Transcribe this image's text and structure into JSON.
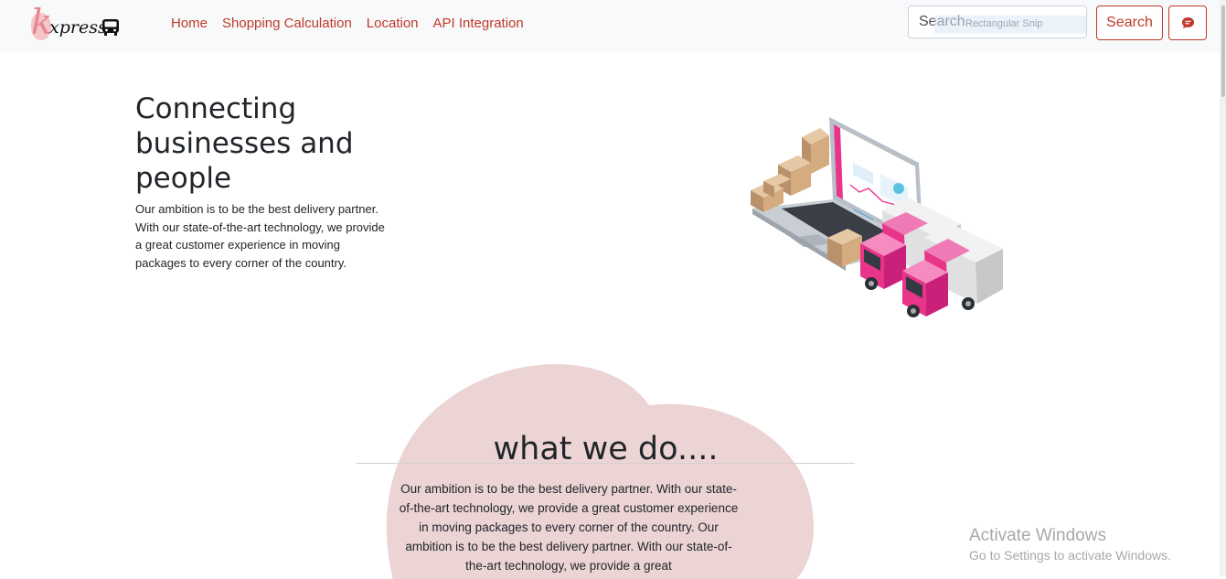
{
  "brand": {
    "letter": "k",
    "name": "xpress"
  },
  "nav": {
    "links": [
      "Home",
      "Shopping Calculation",
      "Location",
      "API Integration"
    ],
    "search_placeholder": "Search",
    "search_button": "Search",
    "snip_hint": "Rectangular Snip"
  },
  "hero": {
    "title": "Connecting businesses and people",
    "text": "Our ambition is to be the best delivery partner. With our state-of-the-art technology, we provide a great customer experience in moving packages to every corner of the country."
  },
  "section": {
    "title": "what we do....",
    "text": "Our ambition is to be the best delivery partner. With our state-of-the-art technology, we provide a great customer experience in moving packages to every corner of the country. Our ambition is to be the best delivery partner. With our state-of-the-art technology, we provide a great"
  },
  "os_watermark": {
    "title": "Activate Windows",
    "subtitle": "Go to Settings to activate Windows."
  },
  "colors": {
    "accent": "#c0392b",
    "blob": "#ecd4d5",
    "navbar_bg": "#f8f9fa",
    "truck_pink": "#e8358a"
  }
}
